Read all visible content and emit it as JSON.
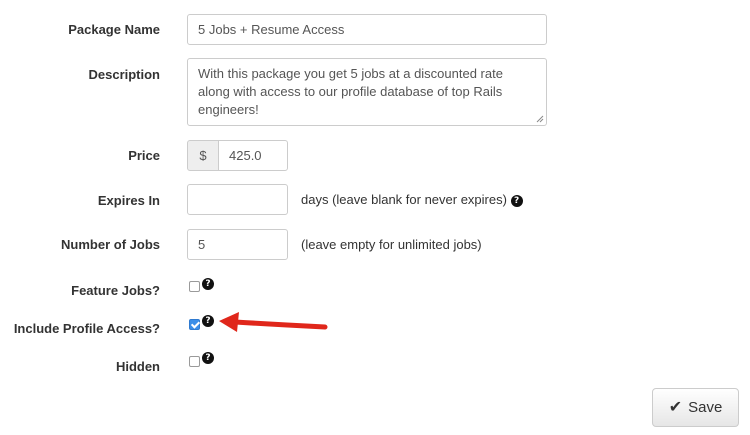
{
  "form": {
    "package_name": {
      "label": "Package Name",
      "value": "5 Jobs + Resume Access"
    },
    "description": {
      "label": "Description",
      "line1": "With this package you get 5 jobs at a discounted rate",
      "line2": "along with access to our profile database of top Rails",
      "line3": "engineers!"
    },
    "price": {
      "label": "Price",
      "currency": "$",
      "value": "425.0"
    },
    "expires_in": {
      "label": "Expires In",
      "value": "",
      "help": "days (leave blank for never expires)"
    },
    "number_of_jobs": {
      "label": "Number of Jobs",
      "value": "5",
      "help": "(leave empty for unlimited jobs)"
    },
    "feature_jobs": {
      "label": "Feature Jobs?",
      "checked": false
    },
    "include_profile_access": {
      "label": "Include Profile Access?",
      "checked": true
    },
    "hidden": {
      "label": "Hidden",
      "checked": false
    }
  },
  "save_button": {
    "label": "Save",
    "icon": "checkmark-icon"
  },
  "help_icon": "?",
  "colors": {
    "arrow": "#e0271b",
    "checkbox_checked": "#3b8ee8"
  }
}
